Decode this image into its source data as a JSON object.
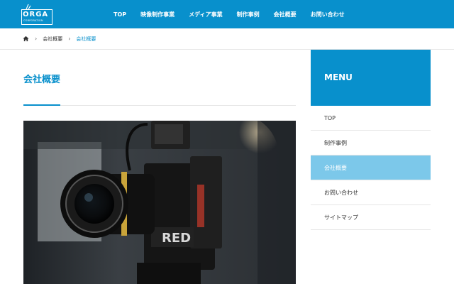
{
  "header": {
    "logo_text": "ORGA",
    "logo_sub": "CORPORATION",
    "nav": [
      "TOP",
      "映像制作事業",
      "メディア事業",
      "制作事例",
      "会社概要",
      "お問い合わせ"
    ]
  },
  "breadcrumb": {
    "home_icon": "home-icon",
    "items": [
      "会社概要",
      "会社概要"
    ]
  },
  "main": {
    "title": "会社概要"
  },
  "sidebar": {
    "title": "MENU",
    "items": [
      "TOP",
      "制作事例",
      "会社概要",
      "お問い合わせ",
      "サイトマップ"
    ],
    "active_index": 2
  },
  "colors": {
    "brand": "#0890cc",
    "active": "#7cc8ea"
  }
}
